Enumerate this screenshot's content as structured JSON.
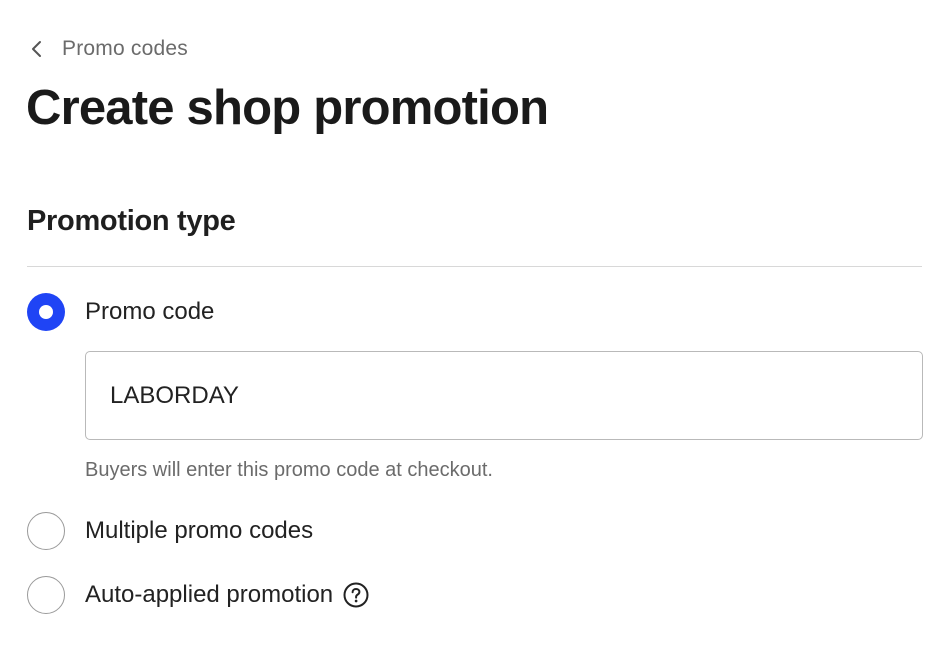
{
  "breadcrumb": {
    "icon": "chevron-left-icon",
    "label": "Promo codes"
  },
  "page": {
    "title": "Create shop promotion"
  },
  "promotion_type": {
    "heading": "Promotion type",
    "options": [
      {
        "label": "Promo code",
        "selected": true
      },
      {
        "label": "Multiple promo codes",
        "selected": false
      },
      {
        "label": "Auto-applied promotion",
        "selected": false,
        "icon": "help-question-icon"
      }
    ],
    "promo_code": {
      "value": "LABORDAY",
      "helper": "Buyers will enter this promo code at checkout."
    }
  },
  "colors": {
    "accent": "#1f44f5",
    "text_primary": "#222222",
    "text_secondary": "#6b6b6b",
    "divider": "#d8d8d8",
    "input_border": "#b9b9b9"
  }
}
